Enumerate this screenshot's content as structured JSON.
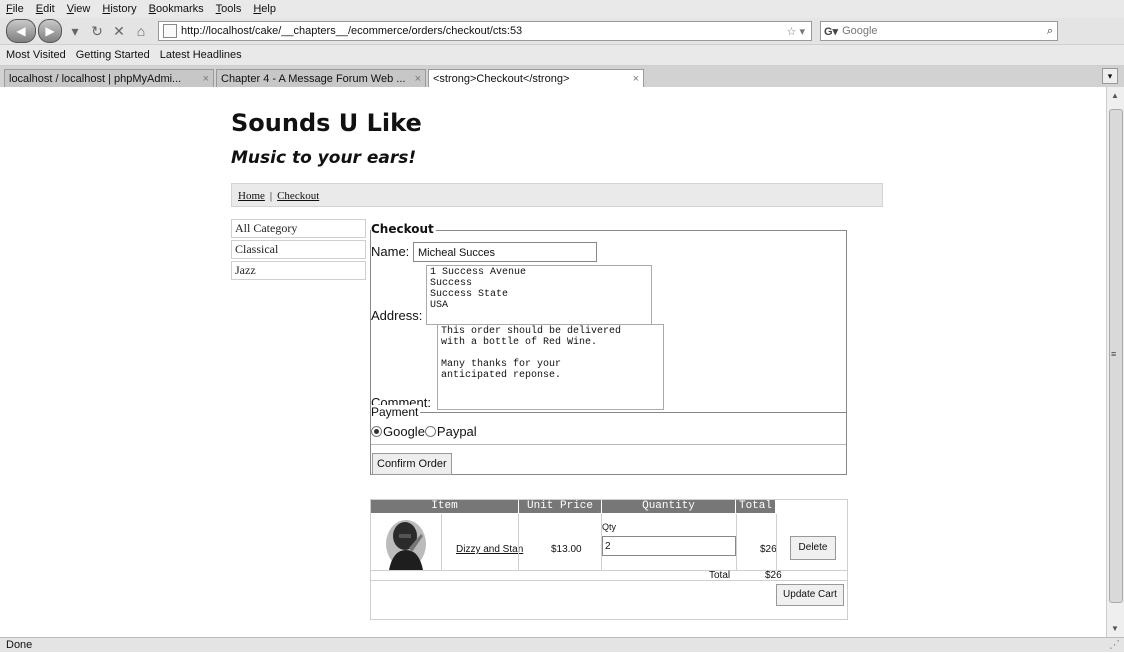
{
  "browser": {
    "menu": [
      "File",
      "Edit",
      "View",
      "History",
      "Bookmarks",
      "Tools",
      "Help"
    ],
    "url": "http://localhost/cake/__chapters__/ecommerce/orders/checkout/cts:53",
    "search_placeholder": "Google",
    "bookmarks": [
      "Most Visited",
      "Getting Started",
      "Latest Headlines"
    ],
    "tabs": [
      {
        "label": "localhost / localhost | phpMyAdmi...",
        "active": false
      },
      {
        "label": "Chapter 4 - A Message Forum Web ...",
        "active": false
      },
      {
        "label": "<strong>Checkout</strong>",
        "active": true
      }
    ],
    "status": "Done"
  },
  "site": {
    "title": "Sounds U Like",
    "slogan": "Music to your ears!"
  },
  "breadcrumb": {
    "home": "Home",
    "separator": "|",
    "current": "Checkout"
  },
  "categories": [
    "All Category",
    "Classical",
    "Jazz"
  ],
  "checkout": {
    "legend": "Checkout",
    "name_label": "Name:",
    "name_value": "Micheal Succes",
    "address_label": "Address:",
    "address_value": "1 Success Avenue\nSuccess\nSuccess State\nUSA",
    "comment_label": "Comment:",
    "comment_value": "This order should be delivered\nwith a bottle of Red Wine.\n\nMany thanks for your\nanticipated reponse.",
    "payment_legend": "Payment",
    "payment_options": [
      "Google",
      "Paypal"
    ],
    "payment_selected": "Google",
    "confirm_label": "Confirm Order"
  },
  "cart": {
    "headers": [
      "Item",
      "Unit Price",
      "Quantity",
      "Total"
    ],
    "items": [
      {
        "name": "Dizzy and Stan",
        "unit_price": "$13.00",
        "qty_label": "Qty",
        "qty": "2",
        "total": "$26",
        "delete_label": "Delete"
      }
    ],
    "total_label": "Total",
    "total_value": "$26",
    "update_label": "Update Cart"
  }
}
